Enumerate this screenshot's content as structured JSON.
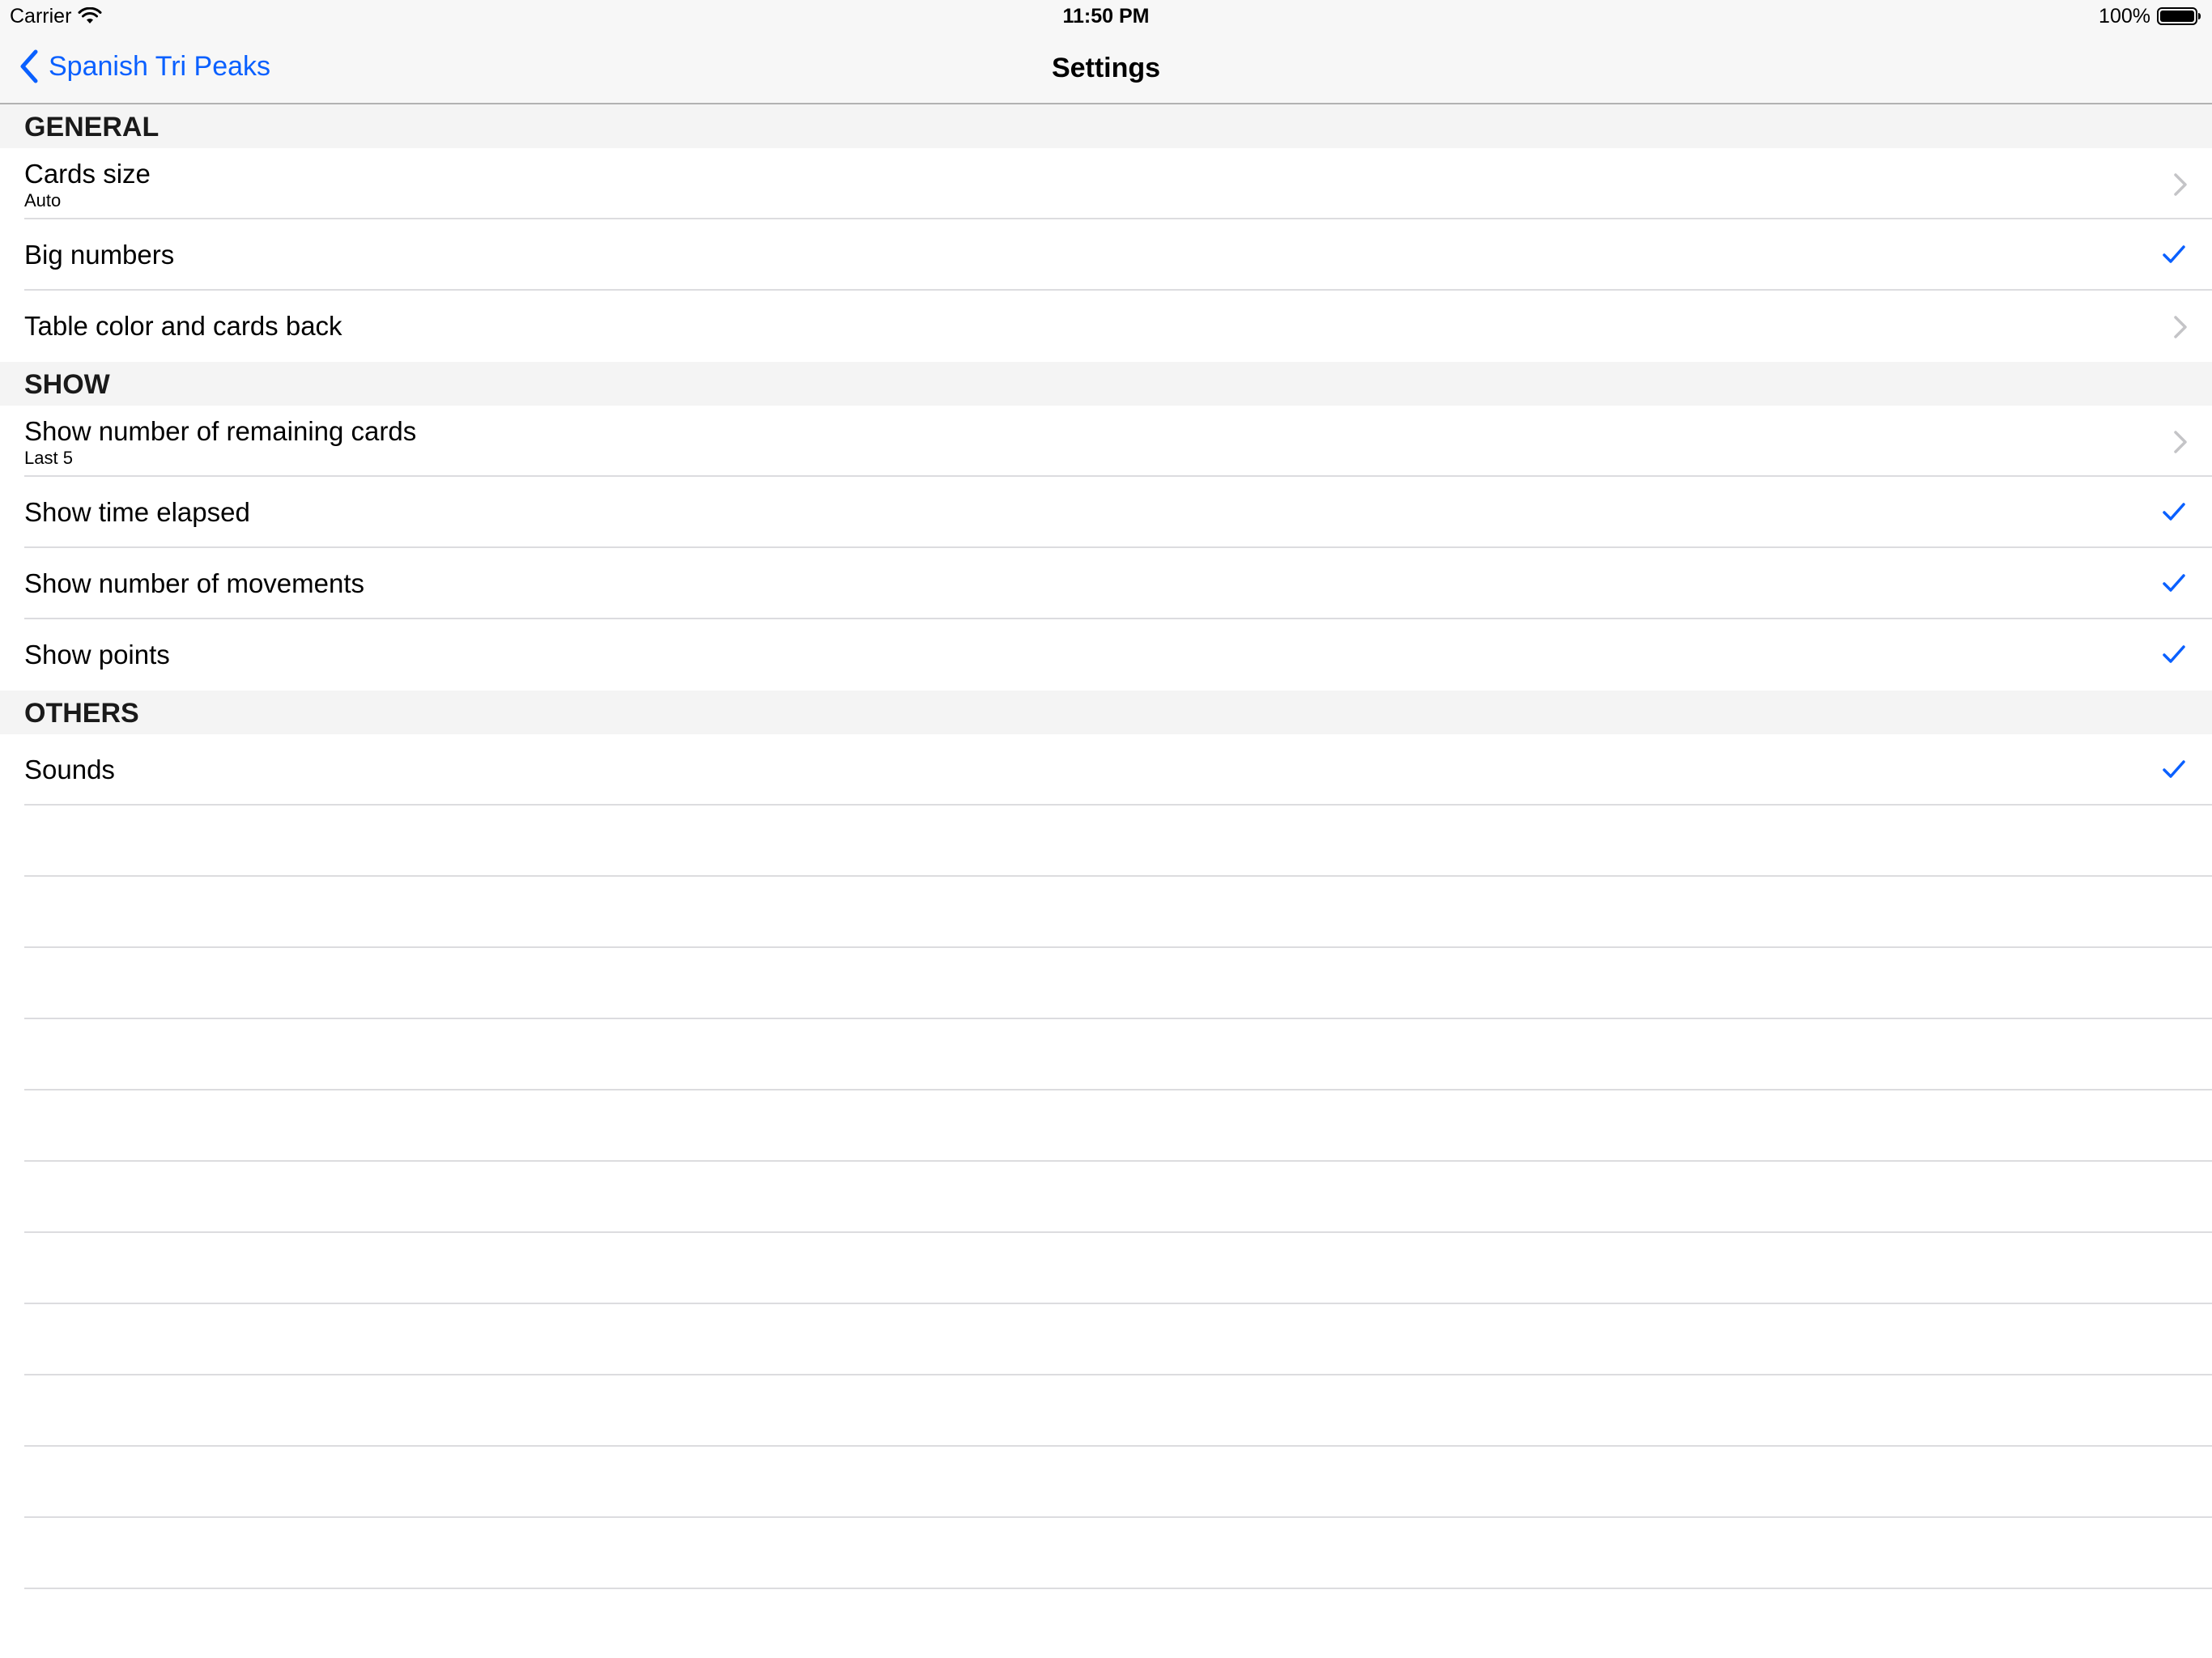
{
  "status_bar": {
    "carrier": "Carrier",
    "time": "11:50 PM",
    "battery": "100%",
    "icons": [
      "wifi-icon",
      "battery-icon"
    ]
  },
  "nav": {
    "back_label": "Spanish Tri Peaks",
    "title": "Settings",
    "back_icon": "chevron-back-icon"
  },
  "colors": {
    "accent": "#0a60ff",
    "header_bg": "#f4f4f4",
    "bar_bg": "#f7f7f7",
    "separator": "#dcdcdf"
  },
  "sections": [
    {
      "header": "GENERAL",
      "rows": [
        {
          "title": "Cards size",
          "subtitle": "Auto",
          "accessory": "chevron-right-icon"
        },
        {
          "title": "Big numbers",
          "accessory": "checkmark-icon"
        },
        {
          "title": "Table color and cards back",
          "accessory": "chevron-right-icon"
        }
      ]
    },
    {
      "header": "SHOW",
      "rows": [
        {
          "title": "Show number of remaining cards",
          "subtitle": "Last 5",
          "accessory": "chevron-right-icon"
        },
        {
          "title": "Show time elapsed",
          "accessory": "checkmark-icon"
        },
        {
          "title": "Show number of movements",
          "accessory": "checkmark-icon"
        },
        {
          "title": "Show points",
          "accessory": "checkmark-icon"
        }
      ]
    },
    {
      "header": "OTHERS",
      "rows": [
        {
          "title": "Sounds",
          "accessory": "checkmark-icon"
        }
      ]
    }
  ]
}
